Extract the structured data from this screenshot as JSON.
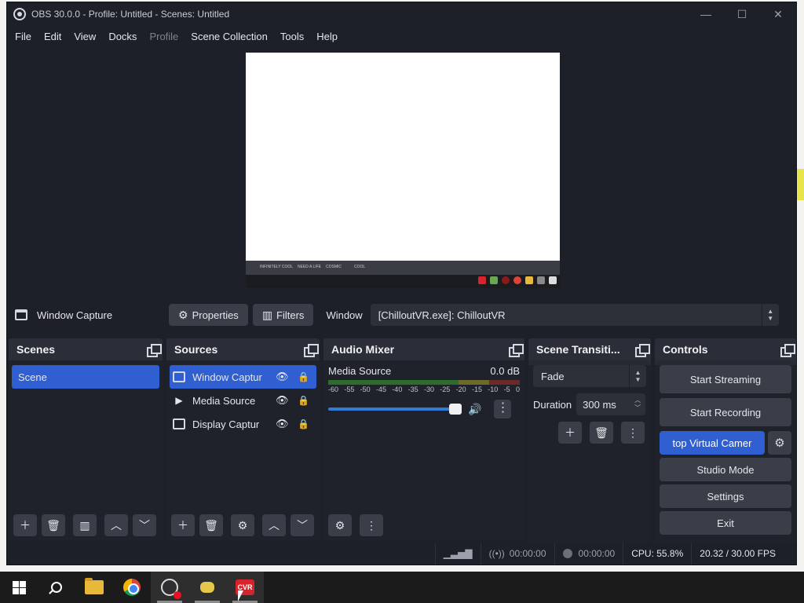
{
  "window": {
    "title": "OBS 30.0.0 - Profile: Untitled - Scenes: Untitled",
    "controls": [
      "—",
      "☐",
      "✕"
    ]
  },
  "menu": [
    "File",
    "Edit",
    "View",
    "Docks",
    "Profile",
    "Scene Collection",
    "Tools",
    "Help"
  ],
  "menu_disabled": [
    "Profile"
  ],
  "preview": {
    "bar_texts": [
      "INFINITELY COOL",
      "NEED A LIFE",
      "COSMIC",
      "COOL"
    ]
  },
  "source_toolbar": {
    "source_name": "Window Capture",
    "properties_label": "Properties",
    "filters_label": "Filters",
    "window_label": "Window",
    "window_value": "[ChilloutVR.exe]: ChilloutVR"
  },
  "docks": {
    "scenes": {
      "title": "Scenes",
      "items": [
        "Scene"
      ]
    },
    "sources": {
      "title": "Sources",
      "items": [
        {
          "label": "Window Captur",
          "icon": "window-icon",
          "visible": true,
          "locked": false
        },
        {
          "label": "Media Source",
          "icon": "play-icon",
          "visible": true,
          "locked": false
        },
        {
          "label": "Display Captur",
          "icon": "display-icon",
          "visible": true,
          "locked": false
        }
      ]
    },
    "audio_mixer": {
      "title": "Audio Mixer",
      "channel": "Media Source",
      "level": "0.0 dB",
      "scale": [
        "-60",
        "-55",
        "-50",
        "-45",
        "-40",
        "-35",
        "-30",
        "-25",
        "-20",
        "-15",
        "-10",
        "-5",
        "0"
      ],
      "volume_fraction": 1.0
    },
    "transitions": {
      "title": "Scene Transiti...",
      "transition": "Fade",
      "duration_label": "Duration",
      "duration_value": "300 ms"
    },
    "controls": {
      "title": "Controls",
      "start_streaming": "Start Streaming",
      "start_recording": "Start Recording",
      "virtual_camera": "top Virtual Camer",
      "studio_mode": "Studio Mode",
      "settings": "Settings",
      "exit": "Exit"
    }
  },
  "status": {
    "stream_time": "00:00:00",
    "record_time": "00:00:00",
    "cpu": "CPU: 55.8%",
    "fps": "20.32 / 30.00 FPS"
  },
  "taskbar": {
    "items": [
      "start-icon",
      "search-icon",
      "file-explorer-icon",
      "chrome-icon",
      "obs-icon",
      "bee-app-icon",
      "chilloutvr-icon"
    ],
    "cvr_label": "CVR"
  },
  "colors": {
    "accent": "#2f5fd1",
    "window_bg": "#1d2028",
    "dock_bg": "#272a33"
  }
}
